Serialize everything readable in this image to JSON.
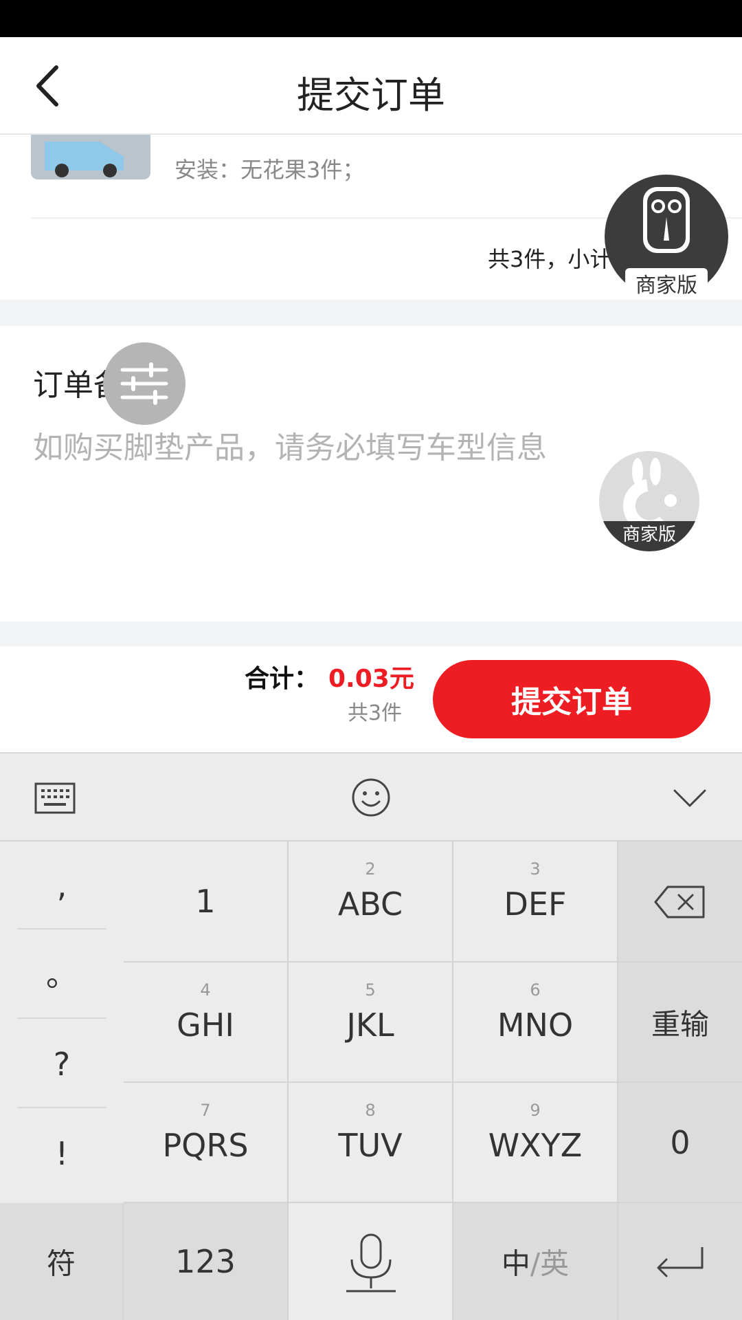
{
  "header": {
    "title": "提交订单"
  },
  "product": {
    "install_text": "安装：无花果3件；",
    "subtotal_text": "共3件，小计"
  },
  "remark": {
    "label": "订单备",
    "placeholder": "如购买脚垫产品，请务必填写车型信息"
  },
  "footer": {
    "total_label": "合计：",
    "total_value": "0.03元",
    "total_count": "共3件",
    "submit_label": "提交订单"
  },
  "floating": {
    "merchant_badge_1": "商家版",
    "merchant_badge_2": "商家版"
  },
  "keyboard": {
    "symbols": [
      ",",
      "。",
      "?",
      "!"
    ],
    "keys": [
      {
        "num": "",
        "letters": "1"
      },
      {
        "num": "2",
        "letters": "ABC"
      },
      {
        "num": "3",
        "letters": "DEF"
      },
      {
        "num": "4",
        "letters": "GHI"
      },
      {
        "num": "5",
        "letters": "JKL"
      },
      {
        "num": "6",
        "letters": "MNO"
      },
      {
        "num": "7",
        "letters": "PQRS"
      },
      {
        "num": "8",
        "letters": "TUV"
      },
      {
        "num": "9",
        "letters": "WXYZ"
      }
    ],
    "reenter_label": "重输",
    "zero_label": "0",
    "symbol_key_label": "符",
    "num_key_label": "123",
    "lang_key_cn": "中",
    "lang_key_sep": "/",
    "lang_key_en": "英"
  },
  "colors": {
    "accent": "#ee1d23",
    "keyboard_bg": "#ececec"
  }
}
